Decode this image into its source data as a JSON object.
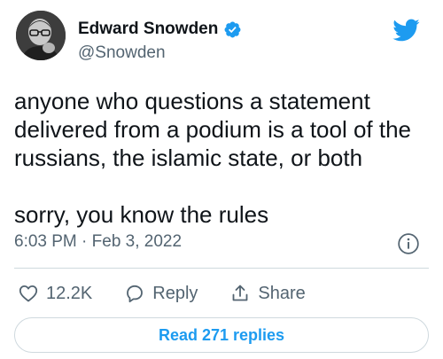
{
  "author": {
    "display_name": "Edward Snowden",
    "handle": "@Snowden",
    "avatar_icon": "avatar-photo",
    "verified_icon": "verified-badge-icon",
    "verified_color": "#1d9bf0"
  },
  "brand": {
    "logo_icon": "twitter-bird-icon",
    "logo_color": "#1d9bf0"
  },
  "tweet": {
    "text": "anyone who questions a statement\ndelivered from a podium is a tool of the\nrussians, the islamic state, or both\n\nsorry, you know the rules",
    "timestamp": "6:03 PM · Feb 3, 2022"
  },
  "actions": {
    "like_count": "12.2K",
    "reply_label": "Reply",
    "share_label": "Share"
  },
  "read_replies_label": "Read 271 replies",
  "colors": {
    "text_primary": "#0f1419",
    "text_secondary": "#536471",
    "accent": "#1d9bf0",
    "border": "#cfd9de"
  }
}
